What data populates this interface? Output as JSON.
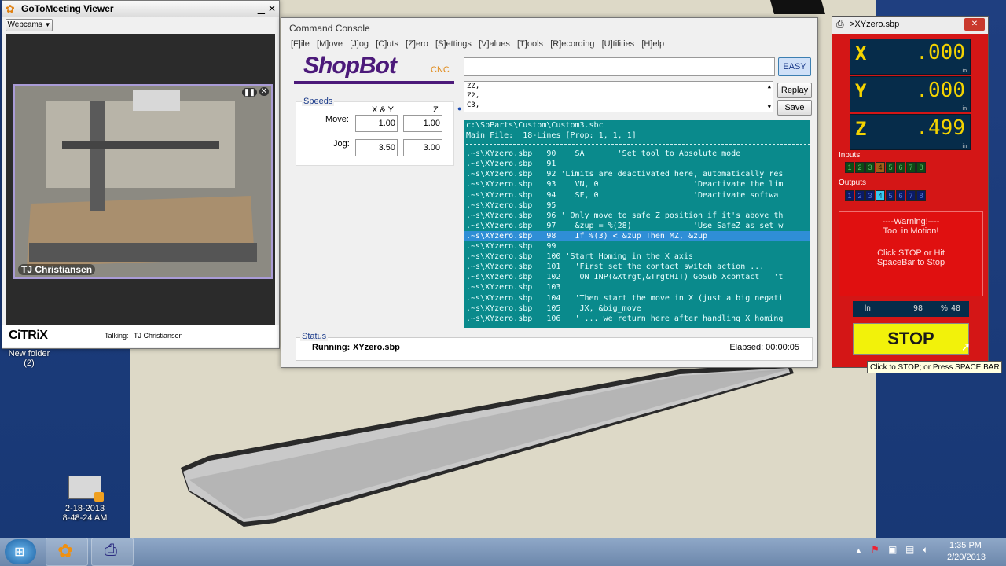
{
  "colors": {
    "shopbot_purple": "#4c1a7a",
    "console_bg": "#0a8a8c",
    "readout_panel": "#d41616",
    "stop_yellow": "#f2f20a",
    "highlight": "#2f8ed6"
  },
  "gotomeeting": {
    "title": "GoToMeeting Viewer",
    "dropdown": "Webcams",
    "presenter": "TJ Christiansen",
    "brand": "CiTRiX",
    "talking_label": "Talking:",
    "talking_name": "TJ Christiansen"
  },
  "desktop": {
    "folder_label": "New folder",
    "folder_count": "(2)",
    "video_date": "2-18-2013",
    "video_time": "8-48-24 AM"
  },
  "console": {
    "title": "Command Console",
    "menu": [
      "[F]ile",
      "[M]ove",
      "[J]og",
      "[C]uts",
      "[Z]ero",
      "[S]ettings",
      "[V]alues",
      "[T]ools",
      "[R]ecording",
      "[U]tilities",
      "[H]elp"
    ],
    "logo": "ShopBot",
    "logo_suffix": "CNC",
    "easy_button": "EASY",
    "replay_button": "Replay",
    "save_button": "Save",
    "history": [
      "ZZ,",
      "Z2,",
      "C3,"
    ],
    "speeds": {
      "title": "Speeds",
      "col_xy": "X & Y",
      "col_z": "Z",
      "move_label": "Move:",
      "jog_label": "Jog:",
      "move_xy": "1.00",
      "move_z": "1.00",
      "jog_xy": "3.50",
      "jog_z": "3.00"
    },
    "log_header": [
      "c:\\SbParts\\Custom\\Custom3.sbc",
      "Main File:  18-Lines [Prop: 1, 1, 1]"
    ],
    "log": [
      ".~s\\XYzero.sbp   90    SA       'Set tool to Absolute mode",
      ".~s\\XYzero.sbp   91",
      ".~s\\XYzero.sbp   92 'Limits are deactivated here, automatically res",
      ".~s\\XYzero.sbp   93    VN, 0                    'Deactivate the lim",
      ".~s\\XYzero.sbp   94    SF, 0                    'Deactivate softwa",
      ".~s\\XYzero.sbp   95",
      ".~s\\XYzero.sbp   96 ' Only move to safe Z position if it's above th",
      ".~s\\XYzero.sbp   97    &zup = %(28)             'Use SafeZ as set w",
      ".~s\\XYzero.sbp   98    If %(3) < &zup Then MZ, &zup",
      ".~s\\XYzero.sbp   99",
      ".~s\\XYzero.sbp   100 'Start Homing in the X axis",
      ".~s\\XYzero.sbp   101   'First set the contact switch action ...",
      ".~s\\XYzero.sbp   102    ON INP(&Xtrgt,&TrgtHIT) GoSub Xcontact   't",
      ".~s\\XYzero.sbp   103",
      ".~s\\XYzero.sbp   104   'Then start the move in X (just a big negati",
      ".~s\\XYzero.sbp   105    JX, &big_move",
      ".~s\\XYzero.sbp   106   ' ... we return here after handling X homing"
    ],
    "status": {
      "title": "Status",
      "running_label": "Running:",
      "running_file": "XYzero.sbp",
      "elapsed": "Elapsed: 00:00:05"
    }
  },
  "readout": {
    "title": ">XYzero.sbp",
    "axes": [
      {
        "label": "X",
        "value": ".000",
        "unit": "in"
      },
      {
        "label": "Y",
        "value": ".000",
        "unit": "in"
      },
      {
        "label": "Z",
        "value": ".499",
        "unit": "in"
      }
    ],
    "inputs_label": "Inputs",
    "inputs": [
      "1",
      "2",
      "3",
      "4",
      "5",
      "6",
      "7",
      "8"
    ],
    "outputs_label": "Outputs",
    "outputs": [
      "1",
      "2",
      "3",
      "4",
      "5",
      "6",
      "7",
      "8"
    ],
    "active_output": 3,
    "active_input": 3,
    "warning": {
      "line1": "----Warning!----",
      "line2": "Tool in Motion!",
      "line3": "Click STOP or Hit",
      "line4": "SpaceBar to Stop"
    },
    "line_label": "ln",
    "line_value": "98",
    "percent_label": "%",
    "percent_value": "48",
    "stop_button": "STOP",
    "tooltip": "Click to STOP; or Press SPACE BAR"
  },
  "taskbar": {
    "time": "1:35 PM",
    "date": "2/20/2013"
  }
}
